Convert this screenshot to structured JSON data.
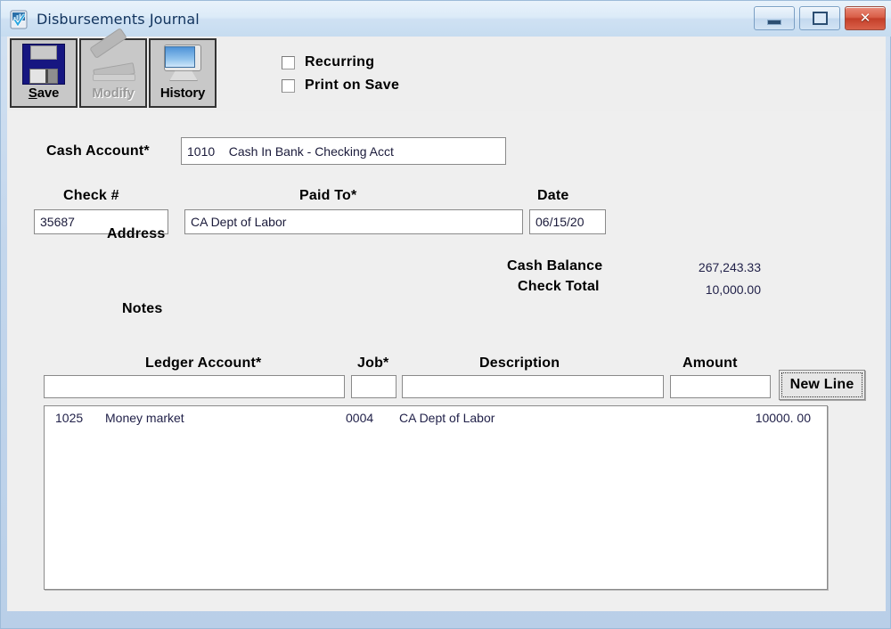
{
  "window": {
    "title": "Disbursements Journal",
    "icon": "journal-icon",
    "buttons": {
      "minimize": "minimize-icon",
      "maximize": "maximize-icon",
      "close": "close-icon"
    }
  },
  "toolbar": {
    "buttons": [
      {
        "label": "Save",
        "accel": "S",
        "icon": "floppy-disk-icon",
        "enabled": true
      },
      {
        "label": "Modify",
        "accel": "M",
        "icon": "stapler-icon",
        "enabled": false
      },
      {
        "label": "History",
        "accel": "",
        "icon": "monitor-icon",
        "enabled": true
      }
    ],
    "checkboxes": [
      {
        "label": "Recurring",
        "checked": false
      },
      {
        "label": "Print on Save",
        "checked": false
      }
    ]
  },
  "form": {
    "cash_account": {
      "label": "Cash Account*",
      "value": "1010    Cash In Bank - Checking Acct"
    },
    "check_number": {
      "label": "Check #",
      "value": "35687"
    },
    "paid_to": {
      "label": "Paid To*",
      "value": "CA Dept of Labor"
    },
    "date": {
      "label": "Date",
      "value": "06/15/20"
    },
    "address": {
      "label": "Address",
      "value": ""
    },
    "notes": {
      "label": "Notes",
      "value": ""
    },
    "cash_balance": {
      "label": "Cash Balance",
      "value": "267,243.33"
    },
    "check_total": {
      "label": "Check Total",
      "value": "10,000.00"
    }
  },
  "line_entry": {
    "headers": {
      "ledger_account": "Ledger Account*",
      "job": "Job*",
      "description": "Description",
      "amount": "Amount"
    },
    "inputs": {
      "ledger_account": "",
      "job": "",
      "description": "",
      "amount": ""
    },
    "new_line_button": "New Line"
  },
  "grid": {
    "rows": [
      {
        "account_code": "1025",
        "account_name": "Money market",
        "job": "0004",
        "description": "CA Dept of Labor",
        "amount": "10000. 00"
      }
    ]
  },
  "colors": {
    "frame": "#c3d6ec",
    "client_bg": "#efefef",
    "toolbar_btn": "#c8c8c8",
    "close_red": "#c43f29",
    "field_text": "#22224a"
  }
}
